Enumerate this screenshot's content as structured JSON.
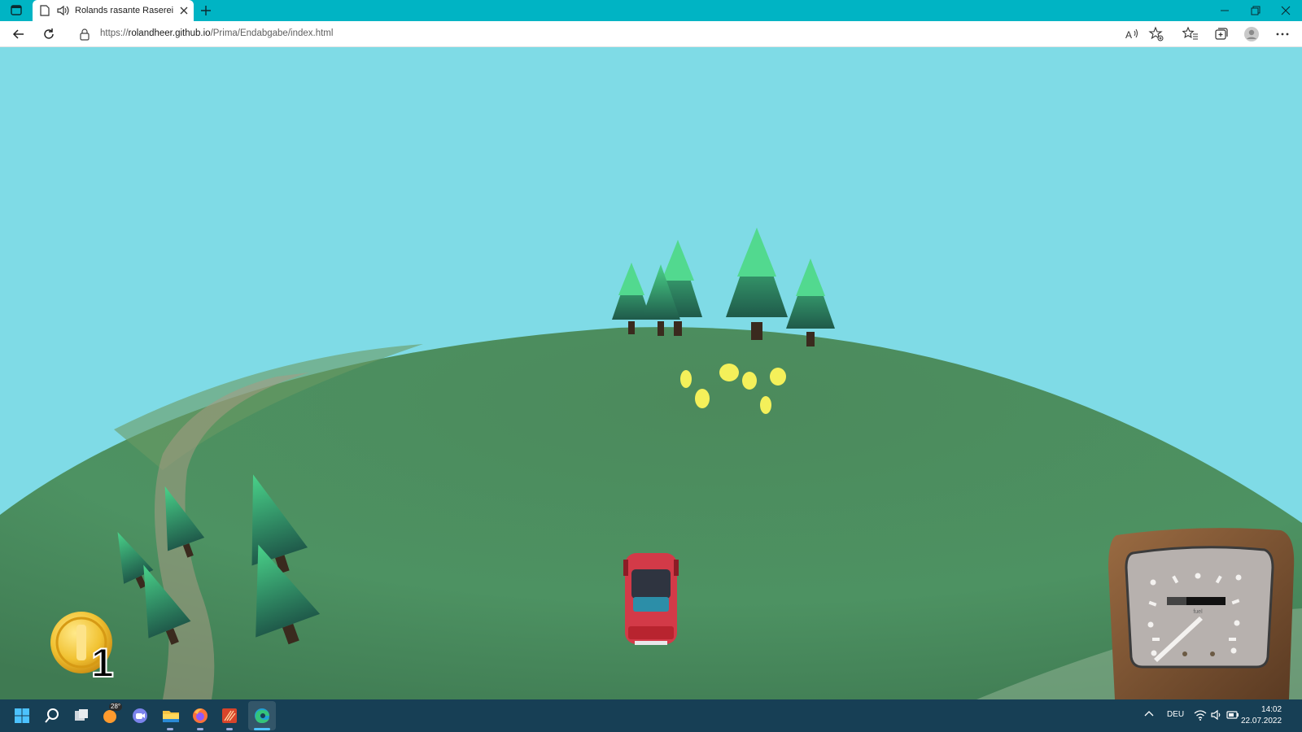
{
  "browser": {
    "tab": {
      "title": "Rolands rasante Raserei"
    },
    "address": {
      "url_prefix": "https://",
      "url_host": "rolandheer.github.io",
      "url_path": "/Prima/Endabgabe/index.html"
    },
    "icons": [
      "tab-actions-icon",
      "page-icon",
      "speaker-icon",
      "close-icon",
      "plus-icon",
      "minimize-icon",
      "restore-icon",
      "close-window-icon",
      "back-icon",
      "reload-icon",
      "lock-icon",
      "read-aloud-icon",
      "add-favorite-icon",
      "favorites-icon",
      "collections-icon",
      "profile-icon",
      "more-icon"
    ]
  },
  "game": {
    "coins": {
      "count": "1"
    },
    "speedometer": {
      "label": "fuel"
    },
    "colors": {
      "sky": "#7fdbe6",
      "hill": "#4d8d5d",
      "car": "#d33a48",
      "coin": "#f1c232",
      "gem": "#f4f05a"
    }
  },
  "taskbar": {
    "weather_badge": "28°",
    "language": "DEU",
    "time": "14:02",
    "date": "22.07.2022",
    "icons": [
      "start-icon",
      "search-icon",
      "task-view-icon",
      "weather-icon",
      "teams-icon",
      "file-explorer-icon",
      "firefox-icon",
      "app-icon",
      "edge-icon",
      "tray-chevron-icon",
      "wifi-icon",
      "volume-icon",
      "battery-icon"
    ]
  }
}
